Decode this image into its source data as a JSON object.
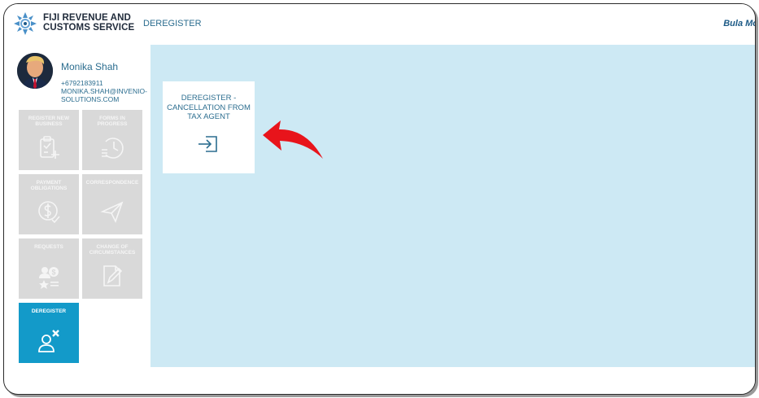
{
  "header": {
    "brand_line1": "FIJI REVENUE AND",
    "brand_line2": "CUSTOMS SERVICE",
    "nav_item": "DEREGISTER",
    "greeting": "Bula Mo"
  },
  "profile": {
    "name": "Monika Shah",
    "phone": "+6792183911",
    "email": "MONIKA.SHAH@INVENIO-SOLUTIONS.COM"
  },
  "sidebar": {
    "tiles": [
      {
        "label": "REGISTER NEW BUSINESS",
        "icon": "clipboard-add-icon"
      },
      {
        "label": "FORMS IN PROGRESS",
        "icon": "clock-list-icon"
      },
      {
        "label": "PAYMENT OBLIGATIONS",
        "icon": "dollar-check-icon"
      },
      {
        "label": "CORRESPONDENCE",
        "icon": "paper-plane-icon"
      },
      {
        "label": "REQUESTS",
        "icon": "people-dollar-icon"
      },
      {
        "label": "CHANGE OF CIRCUMSTANCES",
        "icon": "document-edit-icon"
      },
      {
        "label": "DEREGISTER",
        "icon": "user-remove-icon"
      }
    ]
  },
  "main": {
    "card_title": "DEREGISTER - CANCELLATION FROM TAX AGENT",
    "card_icon": "sign-in-icon"
  },
  "colors": {
    "accent": "#139ac9",
    "main_bg": "#cde9f4",
    "tile_inactive": "#d9d9d9",
    "text_link": "#2b6d8f",
    "arrow": "#e8141b"
  }
}
